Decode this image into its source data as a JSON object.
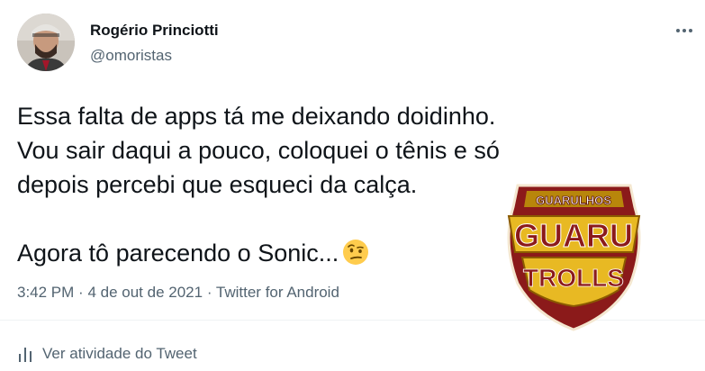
{
  "author": {
    "name": "Rogério Princiotti",
    "handle": "@omoristas"
  },
  "tweet": {
    "paragraph1": "Essa falta de apps tá me deixando doidinho. Vou sair daqui a pouco, coloquei o tênis e só depois percebi que esqueci da calça.",
    "paragraph2": "Agora tô parecendo o Sonic...",
    "emoji": "raised-eyebrow-face"
  },
  "meta": {
    "time": "3:42 PM",
    "separator": "·",
    "date": "4 de out de 2021",
    "source": "Twitter for Android"
  },
  "actions": {
    "activity_label": "Ver atividade do Tweet"
  },
  "watermark": {
    "top_text": "GUARULHOS",
    "middle_text": "GUARU",
    "bottom_text": "TROLLS"
  },
  "colors": {
    "secondary_text": "#536471",
    "primary_text": "#0f1419",
    "logo_red": "#8b1a1a",
    "logo_gold": "#e8b923"
  },
  "icons": {
    "more": "more-dots-icon",
    "activity": "bar-chart-icon"
  }
}
